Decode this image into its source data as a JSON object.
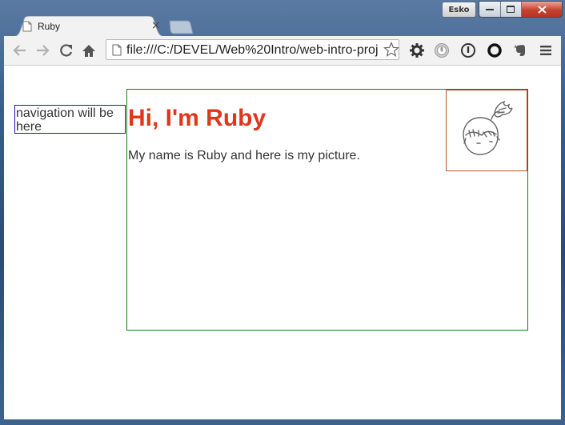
{
  "browser": {
    "profile_name": "Esko",
    "tab": {
      "title": "Ruby",
      "icon": "page-icon",
      "close_glyph": "×"
    },
    "address": {
      "url": "file:///C:/DEVEL/Web%20Intro/web-intro-proj"
    },
    "toolbar_icons": [
      "back-arrow-icon",
      "forward-arrow-icon",
      "reload-icon",
      "home-icon",
      "gear-icon",
      "extension-shield-icon",
      "extension-circle-icon",
      "extension-ring-icon",
      "evernote-icon",
      "menu-icon"
    ]
  },
  "page": {
    "nav_text": "navigation will be here",
    "heading": "Hi, I'm Ruby",
    "intro": "My name is Ruby and here is my picture.",
    "picture_icon": "ruby-avatar-icon"
  },
  "colors": {
    "heading": "#e0361c",
    "nav_border": "#1a1aa8",
    "main_border": "#1c7a1c",
    "picture_border": "#c0502a"
  }
}
